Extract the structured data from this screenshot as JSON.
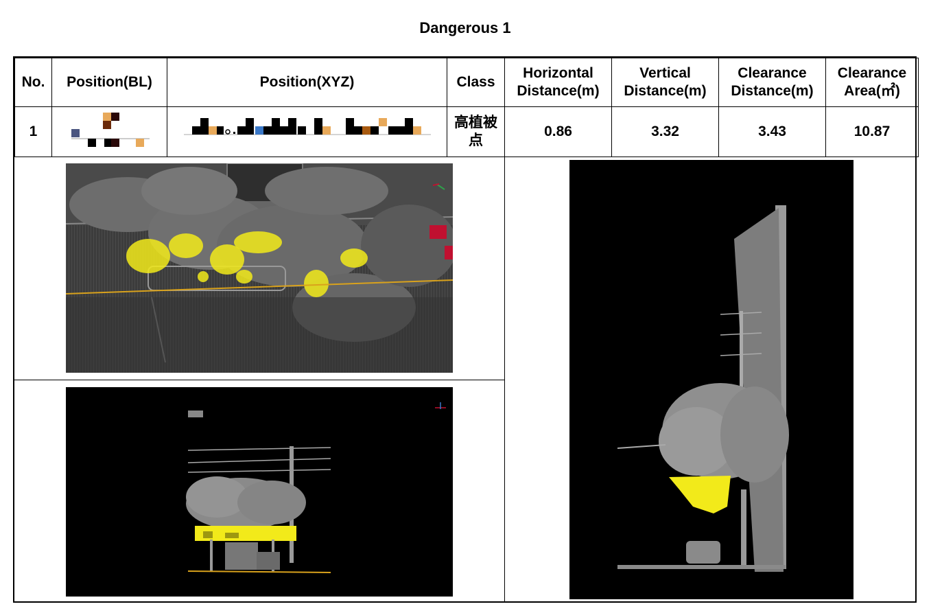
{
  "title": "Dangerous 1",
  "table": {
    "headers": {
      "no": "No.",
      "position_bl": "Position(BL)",
      "position_xyz": "Position(XYZ)",
      "class": "Class",
      "horizontal": [
        "Horizontal",
        "Distance(m)"
      ],
      "vertical": [
        "Vertical",
        "Distance(m)"
      ],
      "clearance_distance": [
        "Clearance",
        "Distance(m)"
      ],
      "clearance_area": [
        "Clearance",
        "Area(㎡)"
      ]
    },
    "rows": [
      {
        "no": "1",
        "position_bl": "",
        "position_xyz": "",
        "class": "高植被点",
        "horizontal_distance": "0.86",
        "vertical_distance": "3.32",
        "clearance_distance": "3.43",
        "clearance_area": "10.87"
      }
    ]
  },
  "colors": {
    "vegetation_gray": "#8a8a8a",
    "danger_yellow": "#f2ea1a",
    "line_orange": "#d9a21c",
    "background_black": "#000000",
    "accent_red": "#c01030"
  },
  "images": {
    "top_view": "point-cloud-top-view",
    "front_view": "point-cloud-front-view",
    "side_view": "point-cloud-side-view"
  }
}
